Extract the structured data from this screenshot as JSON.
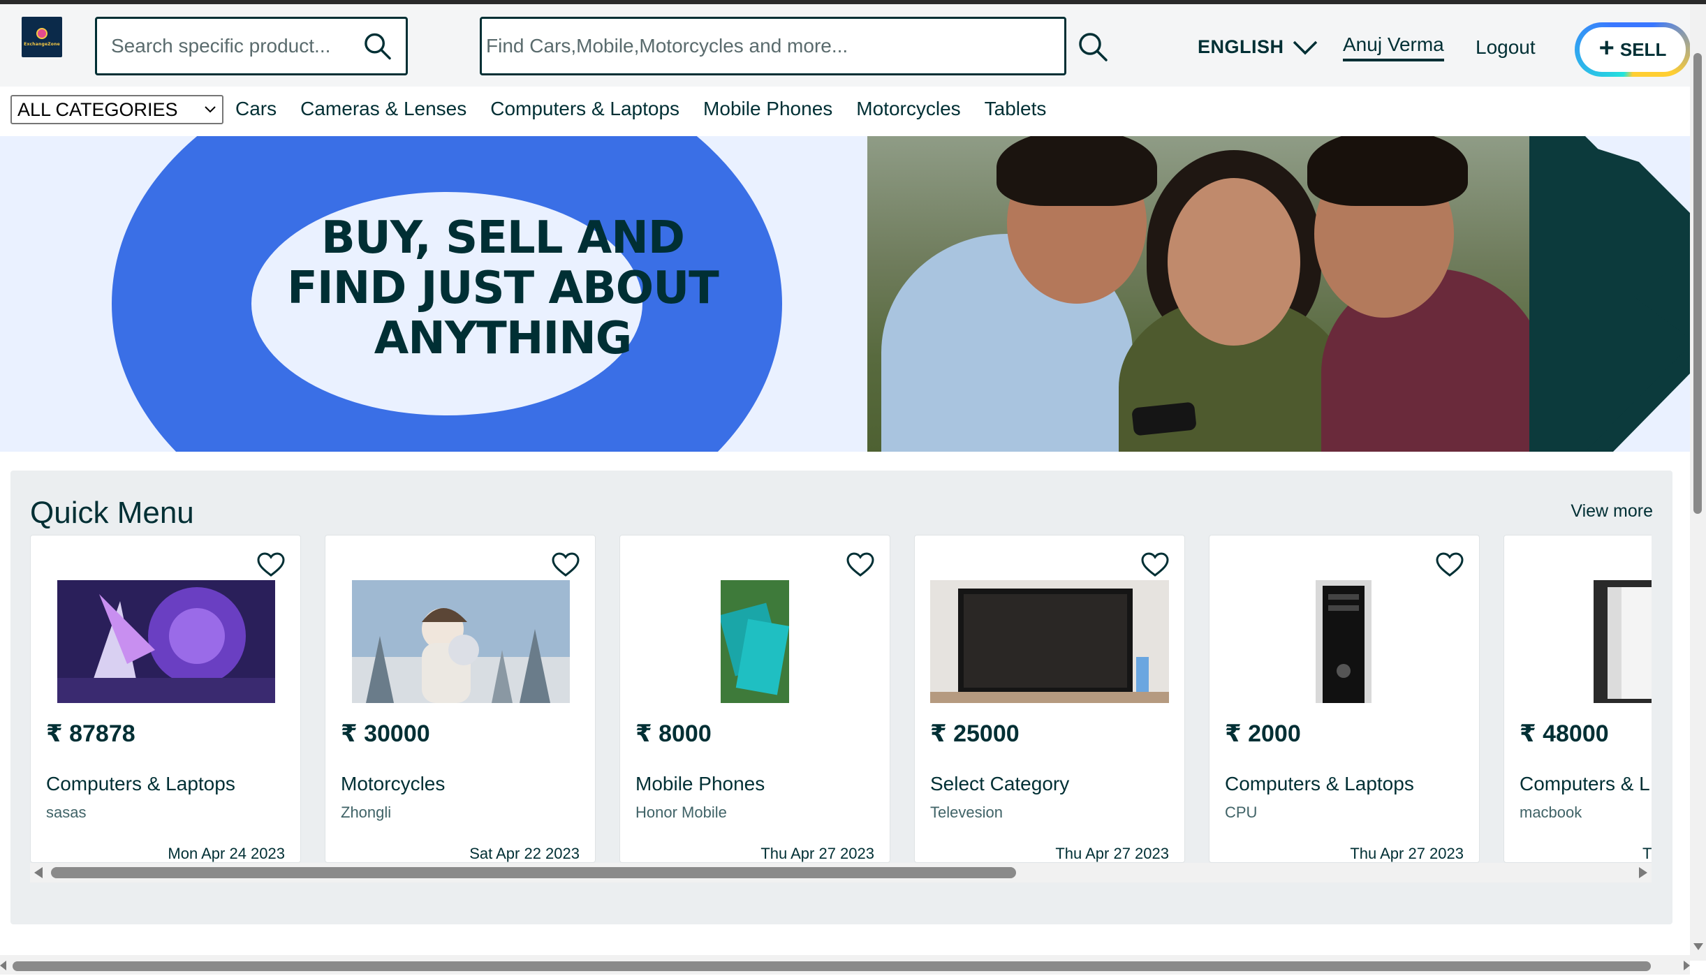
{
  "header": {
    "logo_text": "ExchangeZone",
    "search_product_placeholder": "Search specific product...",
    "search_main_placeholder": "Find Cars,Mobile,Motorcycles and more...",
    "language": "ENGLISH",
    "user_name": "Anuj Verma",
    "logout_label": "Logout",
    "sell_label": "SELL"
  },
  "categories": {
    "select_value": "ALL CATEGORIES",
    "links": [
      "Cars",
      "Cameras & Lenses",
      "Computers & Laptops",
      "Mobile Phones",
      "Motorcycles",
      "Tablets"
    ]
  },
  "banner": {
    "line1": "BUY, SELL AND",
    "line2": "FIND JUST ABOUT",
    "line3": "ANYTHING"
  },
  "quick_menu": {
    "title": "Quick Menu",
    "view_more": "View more",
    "cards": [
      {
        "price": "₹ 87878",
        "category": "Computers & Laptops",
        "title": "sasas",
        "date": "Mon Apr 24 2023",
        "image": "purple-anime-art"
      },
      {
        "price": "₹ 30000",
        "category": "Motorcycles",
        "title": "Zhongli",
        "date": "Sat Apr 22 2023",
        "image": "anime-characters-art"
      },
      {
        "price": "₹ 8000",
        "category": "Mobile Phones",
        "title": "Honor Mobile",
        "date": "Thu Apr 27 2023",
        "image": "mobile-phone-box"
      },
      {
        "price": "₹ 25000",
        "category": "Select Category",
        "title": "Televesion",
        "date": "Thu Apr 27 2023",
        "image": "television"
      },
      {
        "price": "₹ 2000",
        "category": "Computers & Laptops",
        "title": "CPU",
        "date": "Thu Apr 27 2023",
        "image": "cpu-tower"
      },
      {
        "price": "₹ 48000",
        "category": "Computers & L",
        "title": "macbook",
        "date": "T",
        "image": "macbook"
      }
    ]
  },
  "colors": {
    "brand_dark": "#002f34",
    "banner_blue": "#3a6fe6",
    "banner_bg": "#eaf1ff",
    "quick_bg": "#ebeef0"
  }
}
